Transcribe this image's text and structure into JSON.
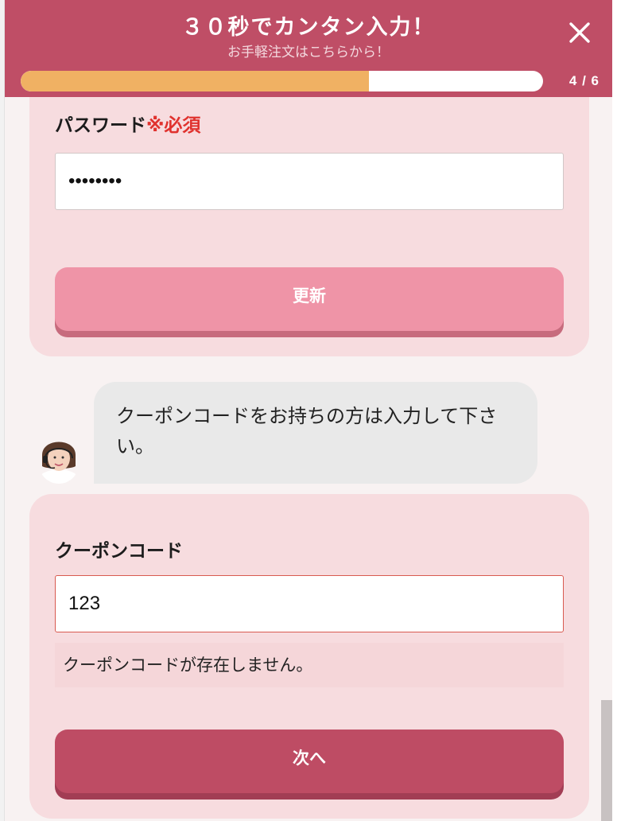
{
  "header": {
    "title": "３０秒でカンタン入力！",
    "subtitle": "お手軽注文はこちらから！",
    "progress_fraction": 0.666,
    "progress_label": "4 / 6"
  },
  "password_section": {
    "label": "パスワード",
    "required": "※必須",
    "value": "••••••••",
    "update_button": "更新"
  },
  "chat": {
    "message": "クーポンコードをお持ちの方は入力して下さい。"
  },
  "coupon_section": {
    "label": "クーポンコード",
    "value": "123",
    "error": "クーポンコードが存在しません。",
    "next_button": "次へ"
  },
  "colors": {
    "header": "#bf4e66",
    "progress": "#f0b163",
    "card": "#f7dcdf",
    "accent_button": "#be4c64",
    "update_button": "#ef94a7",
    "required": "#e0322e"
  },
  "icons": {
    "close": "close-icon",
    "avatar": "operator-avatar"
  }
}
